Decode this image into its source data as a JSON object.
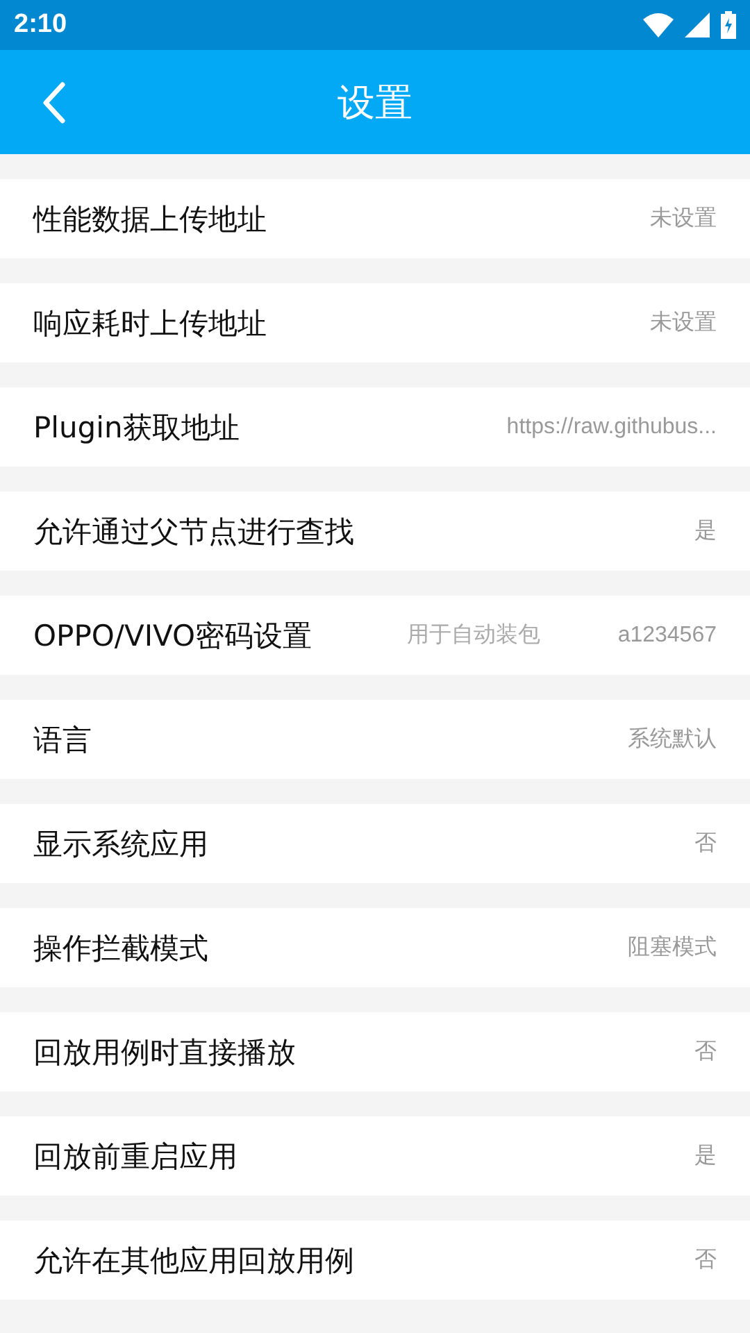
{
  "status_bar": {
    "time": "2:10"
  },
  "toolbar": {
    "title": "设置"
  },
  "settings": [
    {
      "label": "性能数据上传地址",
      "value": "未设置"
    },
    {
      "label": "响应耗时上传地址",
      "value": "未设置"
    },
    {
      "label": "Plugin获取地址",
      "value": "https://raw.githubus..."
    },
    {
      "label": "允许通过父节点进行查找",
      "value": "是"
    },
    {
      "label": "OPPO/VIVO密码设置",
      "hint": "用于自动装包",
      "value": "a1234567"
    },
    {
      "label": "语言",
      "value": "系统默认"
    },
    {
      "label": "显示系统应用",
      "value": "否"
    },
    {
      "label": "操作拦截模式",
      "value": "阻塞模式"
    },
    {
      "label": "回放用例时直接播放",
      "value": "否"
    },
    {
      "label": "回放前重启应用",
      "value": "是"
    },
    {
      "label": "允许在其他应用回放用例",
      "value": "否"
    }
  ]
}
